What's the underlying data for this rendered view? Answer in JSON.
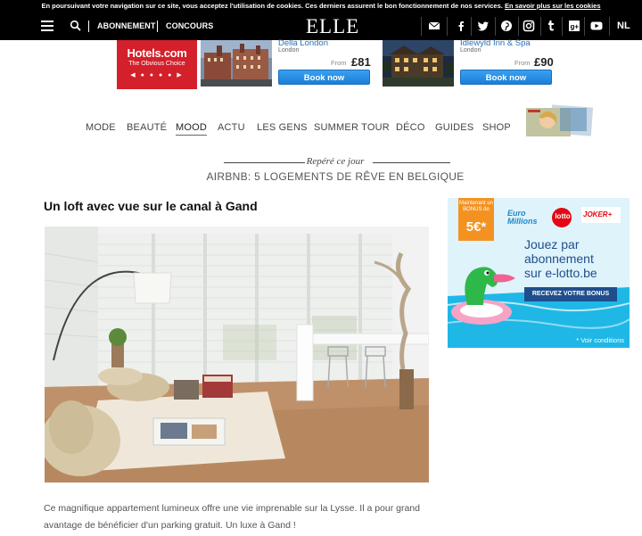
{
  "cookie_bar": {
    "text": "En poursuivant votre navigation sur ce site, vous acceptez l'utilisation de cookies. Ces derniers assurent le bon fonctionnement de nos services.",
    "link": "En savoir plus sur les cookies"
  },
  "header": {
    "abonnement": "ABONNEMENT",
    "concours": "CONCOURS",
    "logo": "ELLE",
    "lang": "NL",
    "social_icons": [
      "mail-icon",
      "facebook-icon",
      "twitter-icon",
      "pinterest-icon",
      "instagram-icon",
      "tumblr-icon",
      "google-plus-icon",
      "youtube-icon"
    ]
  },
  "hotels_ad": {
    "brand": "Hotels.com",
    "tagline": "The Obvious Choice",
    "hotels": [
      {
        "name": "Della London",
        "city": "London",
        "from": "From",
        "price": "£81",
        "button": "Book now"
      },
      {
        "name": "Idlewyld Inn & Spa",
        "city": "London",
        "from": "From",
        "price": "£90",
        "button": "Book now"
      }
    ],
    "brand_color": "#d3202a"
  },
  "main_nav": {
    "items": [
      "MODE",
      "BEAUTÉ",
      "MOOD",
      "ACTU",
      "LES GENS",
      "SUMMER TOUR",
      "DÉCO",
      "GUIDES",
      "SHOP"
    ],
    "active": "MOOD"
  },
  "featured": {
    "label": "Repéré ce jour",
    "headline": "AIRBNB: 5 LOGEMENTS DE RÊVE EN BELGIQUE"
  },
  "article": {
    "title": "Un loft avec vue sur le canal à Gand",
    "text": "Ce magnifique appartement lumineux offre une vie imprenable sur la Lysse. Il a pour grand avantage de bénéficier d'un parking gratuit. Un luxe à Gand !"
  },
  "lotto_ad": {
    "badge_top": "Maintenant un BONUS de",
    "badge_value": "5€*",
    "euromillions": "Euro Millions",
    "lotto": "lotto",
    "joker": "JOKER+",
    "headline_1": "Jouez par",
    "headline_2": "abonnement",
    "headline_3": "sur e-lotto.be",
    "button": "RECEVEZ VOTRE BONUS",
    "footnote": "* Voir conditions"
  }
}
